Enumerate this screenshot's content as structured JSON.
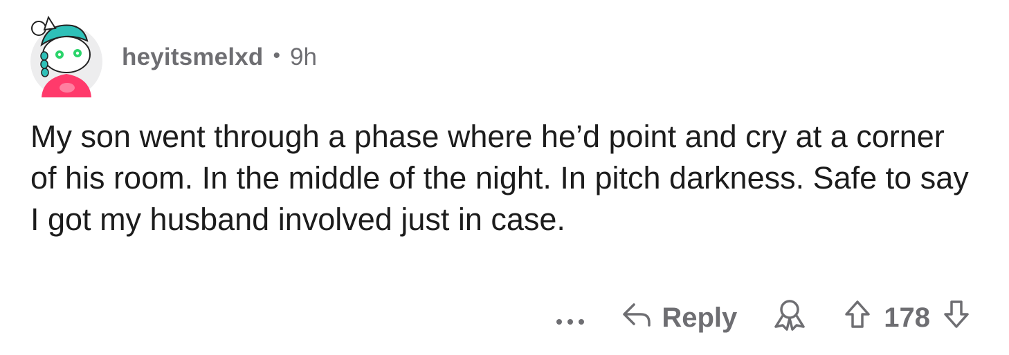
{
  "comment": {
    "author": "heyitsmelxd",
    "separator": "•",
    "age": "9h",
    "body": "My son went through a phase where he’d point and cry at a corner of his room. In the middle of the night. In pitch darkness. Safe to say I got my husband involved just in case.",
    "actions": {
      "more_icon": "ellipsis-icon",
      "reply_label": "Reply",
      "reply_icon": "reply-arrow-icon",
      "award_icon": "award-icon",
      "upvote_icon": "upvote-arrow-icon",
      "score": "178",
      "downvote_icon": "downvote-arrow-icon"
    }
  },
  "colors": {
    "text": "#1c1c1c",
    "meta": "#6e6e72",
    "avatar_hair": "#2fc0b8",
    "avatar_shirt": "#ff3a6b"
  }
}
